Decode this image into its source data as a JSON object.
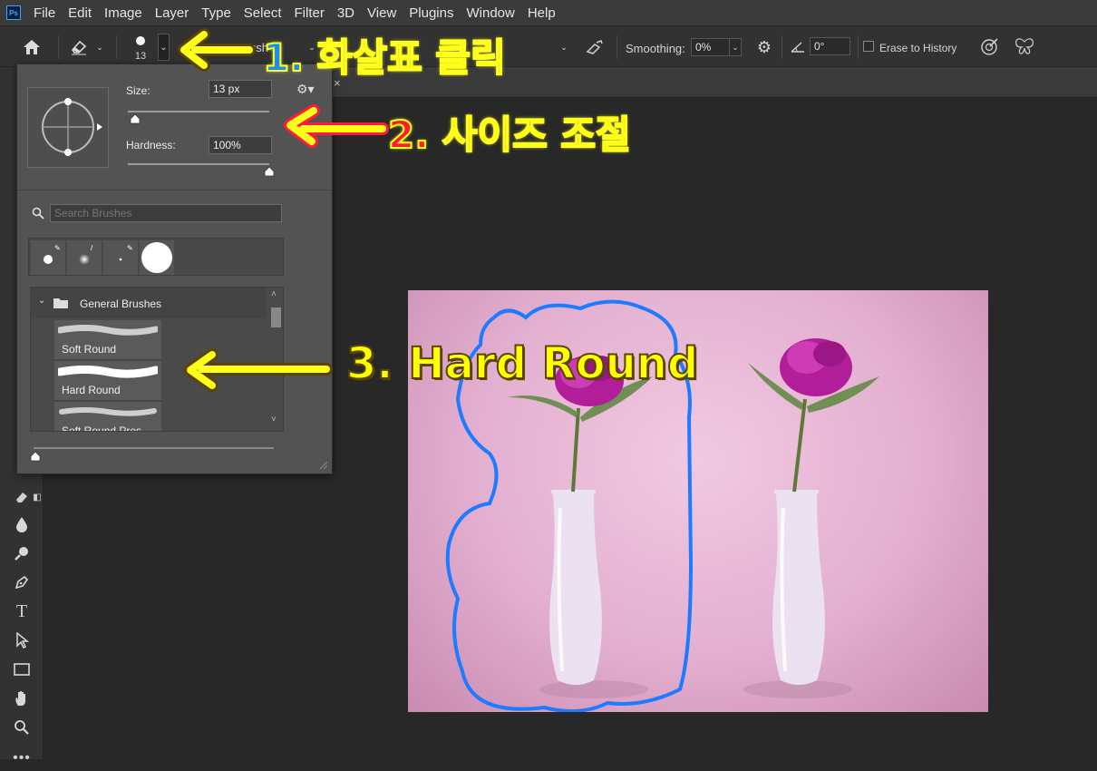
{
  "app": {
    "logo_text": "Ps"
  },
  "menu": [
    "File",
    "Edit",
    "Image",
    "Layer",
    "Type",
    "Select",
    "Filter",
    "3D",
    "View",
    "Plugins",
    "Window",
    "Help"
  ],
  "options": {
    "brush_size": "13",
    "mode_label": "Brush",
    "smoothing_label": "Smoothing:",
    "smoothing_value": "0%",
    "angle_value": "0°",
    "erase_history_label": "Erase to History"
  },
  "brush_panel": {
    "size_label": "Size:",
    "size_value": "13 px",
    "size_fraction": 0.01,
    "hardness_label": "Hardness:",
    "hardness_value": "100%",
    "hardness_fraction": 1.0,
    "search_placeholder": "Search Brushes",
    "folder_name": "General Brushes",
    "brushes": [
      "Soft Round",
      "Hard Round",
      "Soft Round Pres"
    ]
  },
  "annotations": {
    "step1": "1. 화살표 클릭",
    "step2": "2. 사이즈 조절",
    "step3": "3. Hard Round"
  },
  "colors": {
    "annotation_yellow": "#ffff1a",
    "step1_text": "#1a8cff",
    "step2_text": "#ff1a3c",
    "step3_text": "#ffff00",
    "selection_outline": "#1e7bff"
  }
}
